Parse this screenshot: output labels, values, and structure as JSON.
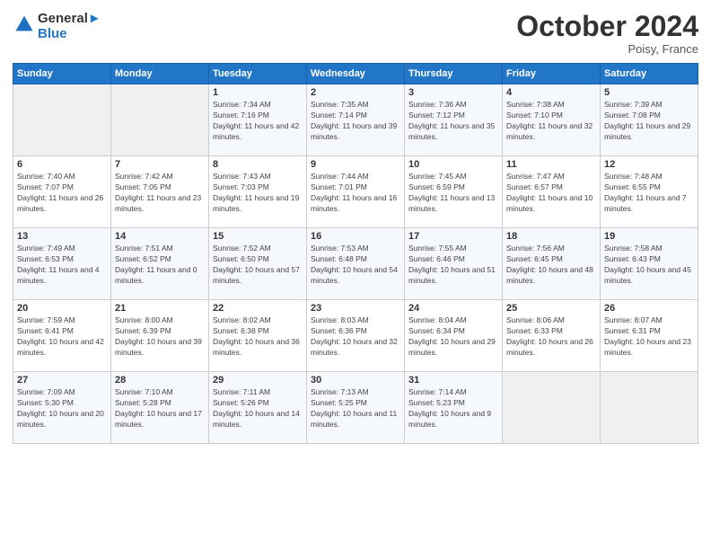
{
  "logo": {
    "line1": "General",
    "line2": "Blue"
  },
  "title": "October 2024",
  "location": "Poisy, France",
  "days_of_week": [
    "Sunday",
    "Monday",
    "Tuesday",
    "Wednesday",
    "Thursday",
    "Friday",
    "Saturday"
  ],
  "weeks": [
    [
      {
        "num": "",
        "sunrise": "",
        "sunset": "",
        "daylight": ""
      },
      {
        "num": "",
        "sunrise": "",
        "sunset": "",
        "daylight": ""
      },
      {
        "num": "1",
        "sunrise": "Sunrise: 7:34 AM",
        "sunset": "Sunset: 7:16 PM",
        "daylight": "Daylight: 11 hours and 42 minutes."
      },
      {
        "num": "2",
        "sunrise": "Sunrise: 7:35 AM",
        "sunset": "Sunset: 7:14 PM",
        "daylight": "Daylight: 11 hours and 39 minutes."
      },
      {
        "num": "3",
        "sunrise": "Sunrise: 7:36 AM",
        "sunset": "Sunset: 7:12 PM",
        "daylight": "Daylight: 11 hours and 35 minutes."
      },
      {
        "num": "4",
        "sunrise": "Sunrise: 7:38 AM",
        "sunset": "Sunset: 7:10 PM",
        "daylight": "Daylight: 11 hours and 32 minutes."
      },
      {
        "num": "5",
        "sunrise": "Sunrise: 7:39 AM",
        "sunset": "Sunset: 7:08 PM",
        "daylight": "Daylight: 11 hours and 29 minutes."
      }
    ],
    [
      {
        "num": "6",
        "sunrise": "Sunrise: 7:40 AM",
        "sunset": "Sunset: 7:07 PM",
        "daylight": "Daylight: 11 hours and 26 minutes."
      },
      {
        "num": "7",
        "sunrise": "Sunrise: 7:42 AM",
        "sunset": "Sunset: 7:05 PM",
        "daylight": "Daylight: 11 hours and 23 minutes."
      },
      {
        "num": "8",
        "sunrise": "Sunrise: 7:43 AM",
        "sunset": "Sunset: 7:03 PM",
        "daylight": "Daylight: 11 hours and 19 minutes."
      },
      {
        "num": "9",
        "sunrise": "Sunrise: 7:44 AM",
        "sunset": "Sunset: 7:01 PM",
        "daylight": "Daylight: 11 hours and 16 minutes."
      },
      {
        "num": "10",
        "sunrise": "Sunrise: 7:45 AM",
        "sunset": "Sunset: 6:59 PM",
        "daylight": "Daylight: 11 hours and 13 minutes."
      },
      {
        "num": "11",
        "sunrise": "Sunrise: 7:47 AM",
        "sunset": "Sunset: 6:57 PM",
        "daylight": "Daylight: 11 hours and 10 minutes."
      },
      {
        "num": "12",
        "sunrise": "Sunrise: 7:48 AM",
        "sunset": "Sunset: 6:55 PM",
        "daylight": "Daylight: 11 hours and 7 minutes."
      }
    ],
    [
      {
        "num": "13",
        "sunrise": "Sunrise: 7:49 AM",
        "sunset": "Sunset: 6:53 PM",
        "daylight": "Daylight: 11 hours and 4 minutes."
      },
      {
        "num": "14",
        "sunrise": "Sunrise: 7:51 AM",
        "sunset": "Sunset: 6:52 PM",
        "daylight": "Daylight: 11 hours and 0 minutes."
      },
      {
        "num": "15",
        "sunrise": "Sunrise: 7:52 AM",
        "sunset": "Sunset: 6:50 PM",
        "daylight": "Daylight: 10 hours and 57 minutes."
      },
      {
        "num": "16",
        "sunrise": "Sunrise: 7:53 AM",
        "sunset": "Sunset: 6:48 PM",
        "daylight": "Daylight: 10 hours and 54 minutes."
      },
      {
        "num": "17",
        "sunrise": "Sunrise: 7:55 AM",
        "sunset": "Sunset: 6:46 PM",
        "daylight": "Daylight: 10 hours and 51 minutes."
      },
      {
        "num": "18",
        "sunrise": "Sunrise: 7:56 AM",
        "sunset": "Sunset: 6:45 PM",
        "daylight": "Daylight: 10 hours and 48 minutes."
      },
      {
        "num": "19",
        "sunrise": "Sunrise: 7:58 AM",
        "sunset": "Sunset: 6:43 PM",
        "daylight": "Daylight: 10 hours and 45 minutes."
      }
    ],
    [
      {
        "num": "20",
        "sunrise": "Sunrise: 7:59 AM",
        "sunset": "Sunset: 6:41 PM",
        "daylight": "Daylight: 10 hours and 42 minutes."
      },
      {
        "num": "21",
        "sunrise": "Sunrise: 8:00 AM",
        "sunset": "Sunset: 6:39 PM",
        "daylight": "Daylight: 10 hours and 39 minutes."
      },
      {
        "num": "22",
        "sunrise": "Sunrise: 8:02 AM",
        "sunset": "Sunset: 6:38 PM",
        "daylight": "Daylight: 10 hours and 36 minutes."
      },
      {
        "num": "23",
        "sunrise": "Sunrise: 8:03 AM",
        "sunset": "Sunset: 6:36 PM",
        "daylight": "Daylight: 10 hours and 32 minutes."
      },
      {
        "num": "24",
        "sunrise": "Sunrise: 8:04 AM",
        "sunset": "Sunset: 6:34 PM",
        "daylight": "Daylight: 10 hours and 29 minutes."
      },
      {
        "num": "25",
        "sunrise": "Sunrise: 8:06 AM",
        "sunset": "Sunset: 6:33 PM",
        "daylight": "Daylight: 10 hours and 26 minutes."
      },
      {
        "num": "26",
        "sunrise": "Sunrise: 8:07 AM",
        "sunset": "Sunset: 6:31 PM",
        "daylight": "Daylight: 10 hours and 23 minutes."
      }
    ],
    [
      {
        "num": "27",
        "sunrise": "Sunrise: 7:09 AM",
        "sunset": "Sunset: 5:30 PM",
        "daylight": "Daylight: 10 hours and 20 minutes."
      },
      {
        "num": "28",
        "sunrise": "Sunrise: 7:10 AM",
        "sunset": "Sunset: 5:28 PM",
        "daylight": "Daylight: 10 hours and 17 minutes."
      },
      {
        "num": "29",
        "sunrise": "Sunrise: 7:11 AM",
        "sunset": "Sunset: 5:26 PM",
        "daylight": "Daylight: 10 hours and 14 minutes."
      },
      {
        "num": "30",
        "sunrise": "Sunrise: 7:13 AM",
        "sunset": "Sunset: 5:25 PM",
        "daylight": "Daylight: 10 hours and 11 minutes."
      },
      {
        "num": "31",
        "sunrise": "Sunrise: 7:14 AM",
        "sunset": "Sunset: 5:23 PM",
        "daylight": "Daylight: 10 hours and 9 minutes."
      },
      {
        "num": "",
        "sunrise": "",
        "sunset": "",
        "daylight": ""
      },
      {
        "num": "",
        "sunrise": "",
        "sunset": "",
        "daylight": ""
      }
    ]
  ]
}
